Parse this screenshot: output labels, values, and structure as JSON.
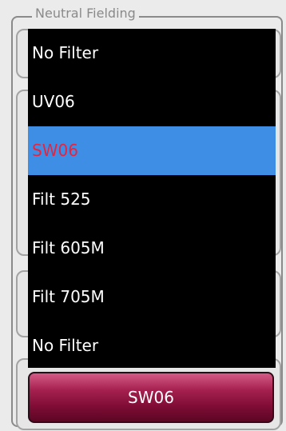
{
  "group": {
    "title": "Neutral Fielding"
  },
  "dropdown": {
    "options": [
      {
        "label": "No Filter",
        "selected": false
      },
      {
        "label": "UV06",
        "selected": false
      },
      {
        "label": "SW06",
        "selected": true
      },
      {
        "label": "Filt 525",
        "selected": false
      },
      {
        "label": "Filt 605M",
        "selected": false
      },
      {
        "label": "Filt 705M",
        "selected": false
      },
      {
        "label": "No Filter",
        "selected": false
      }
    ]
  },
  "selected_button": {
    "label": "SW06"
  },
  "colors": {
    "dropdown_bg": "#000000",
    "highlight_bg": "#3f8ee6",
    "selected_text": "#e8243d",
    "button_maroon": "#7d0c34"
  }
}
